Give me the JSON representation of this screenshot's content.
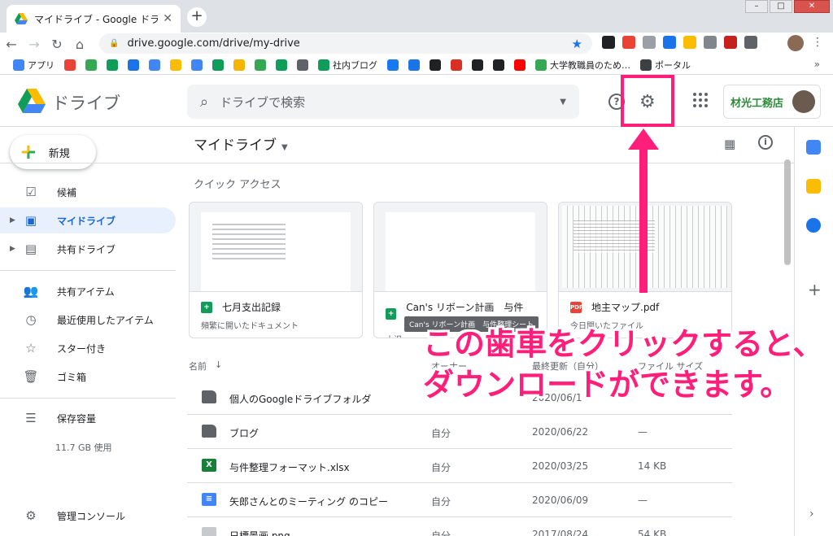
{
  "browser": {
    "tab_title": "マイドライブ - Google ドライブ",
    "new_tab_symbol": "+",
    "close_symbol": "✕",
    "url": "drive.google.com/drive/my-drive",
    "bookmarks": [
      {
        "label": "アプリ",
        "color": "#4285f4"
      },
      {
        "label": "",
        "color": "#ea4335"
      },
      {
        "label": "",
        "color": "#34a853"
      },
      {
        "label": "",
        "color": "#0f9d58"
      },
      {
        "label": "",
        "color": "#1a73e8"
      },
      {
        "label": "",
        "color": "#4285f4"
      },
      {
        "label": "",
        "color": "#fbbc04"
      },
      {
        "label": "",
        "color": "#4285f4"
      },
      {
        "label": "",
        "color": "#0f9d58"
      },
      {
        "label": "",
        "color": "#f4b400"
      },
      {
        "label": "",
        "color": "#34a853"
      },
      {
        "label": "",
        "color": "#0f9d58"
      },
      {
        "label": "",
        "color": "#5f6368"
      },
      {
        "label": "社内ブログ",
        "color": "#0f9d58"
      },
      {
        "label": "",
        "color": "#1877f2"
      },
      {
        "label": "",
        "color": "#1a73e8"
      },
      {
        "label": "",
        "color": "#202124"
      },
      {
        "label": "",
        "color": "#d93025"
      },
      {
        "label": "",
        "color": "#202124"
      },
      {
        "label": "",
        "color": "#202124"
      },
      {
        "label": "",
        "color": "#ff0000"
      },
      {
        "label": "大学教職員のため…",
        "color": "#34a853"
      },
      {
        "label": "ポータル",
        "color": "#3c4043"
      }
    ],
    "more_bookmarks": "»"
  },
  "header": {
    "brand": "ドライブ",
    "search_placeholder": "ドライブで検索",
    "help_label": "?",
    "company_name": "材光工務店"
  },
  "sidebar": {
    "new_label": "新規",
    "items": [
      {
        "label": "候補",
        "icon": "check-box-icon"
      },
      {
        "label": "マイドライブ",
        "icon": "my-drive-icon",
        "active": true
      },
      {
        "label": "共有ドライブ",
        "icon": "shared-drive-icon"
      },
      {
        "label": "共有アイテム",
        "icon": "people-icon"
      },
      {
        "label": "最近使用したアイテム",
        "icon": "clock-icon"
      },
      {
        "label": "スター付き",
        "icon": "star-icon"
      },
      {
        "label": "ゴミ箱",
        "icon": "trash-icon"
      },
      {
        "label": "保存容量",
        "icon": "storage-icon"
      },
      {
        "label": "管理コンソール",
        "icon": "admin-icon"
      }
    ],
    "storage_used": "11.7 GB 使用"
  },
  "main": {
    "breadcrumb": "マイドライブ",
    "quick_access_title": "クイック アクセス",
    "cards": [
      {
        "name": "七月支出記録",
        "sub": "頻繁に開いたドキュメント",
        "type": "sheet"
      },
      {
        "name": "Can's リボーン計画　与件整…",
        "sub": "大沢",
        "type": "sheet"
      },
      {
        "name": "地主マップ.pdf",
        "sub": "今日開いたファイル",
        "type": "pdf"
      }
    ],
    "tooltip": "Can's リボーン計画　与件整理シート",
    "columns": {
      "name": "名前",
      "sort_arrow": "↓",
      "owner": "オーナー",
      "modified": "最終更新（自分）",
      "size": "ファイル サイズ"
    },
    "rows": [
      {
        "name": "個人のGoogleドライブフォルダ",
        "owner": "",
        "date": "2020/06/1",
        "size": "",
        "type": "folder"
      },
      {
        "name": "ブログ",
        "owner": "自分",
        "date": "2020/06/22",
        "size": "—",
        "type": "folder"
      },
      {
        "name": "与件整理フォーマット.xlsx",
        "owner": "自分",
        "date": "2020/03/25",
        "size": "14 KB",
        "type": "excel"
      },
      {
        "name": "矢郎さんとのミーティング のコピー",
        "owner": "自分",
        "date": "2020/06/09",
        "size": "—",
        "type": "doc"
      },
      {
        "name": "日標景画.png",
        "owner": "自分",
        "date": "2017/08/24",
        "size": "54 KB",
        "type": "image"
      }
    ]
  },
  "annotation": {
    "line1": "この歯車をクリックすると、",
    "line2": "ダウンロードができます。",
    "color": "#ff1f7a"
  }
}
